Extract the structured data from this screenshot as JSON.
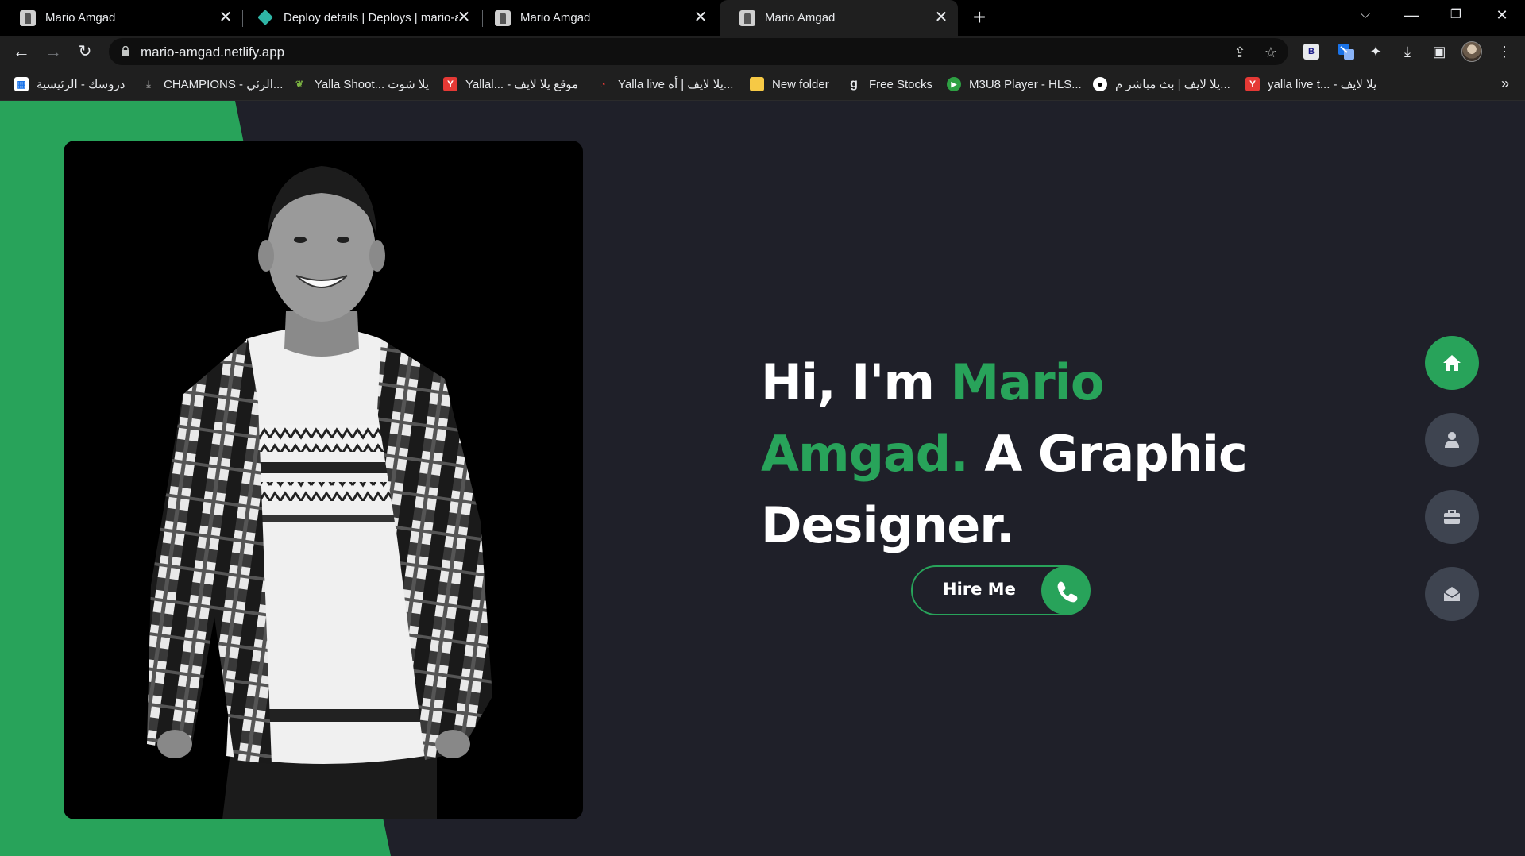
{
  "browser": {
    "tabs": [
      {
        "title": "Mario Amgad",
        "icon": "portrait-favicon"
      },
      {
        "title": "Deploy details | Deploys | mario-a",
        "icon": "netlify-icon"
      },
      {
        "title": "Mario Amgad",
        "icon": "portrait-favicon"
      },
      {
        "title": "Mario Amgad",
        "icon": "portrait-favicon",
        "active": true
      }
    ],
    "url": "mario-amgad.netlify.app",
    "bookmarks": [
      {
        "label": "دروسك - الرئيسية",
        "icon": "site-icon"
      },
      {
        "label": "CHAMPIONS - الرئي...",
        "icon": "download-icon"
      },
      {
        "label": "Yalla Shoot... يلا شوت",
        "icon": "leaf-icon"
      },
      {
        "label": "Yallal... - موقع يلا لايف",
        "icon": "y-icon"
      },
      {
        "label": "Yalla live يلا لايف | أه...",
        "icon": "red-icon"
      },
      {
        "label": "New folder",
        "icon": "folder-icon"
      },
      {
        "label": "Free Stocks",
        "icon": "g-icon"
      },
      {
        "label": "M3U8 Player - HLS...",
        "icon": "play-icon"
      },
      {
        "label": "يلا لايف | بث مباشر م...",
        "icon": "ball-icon"
      },
      {
        "label": "yalla live t... - يلا لايف",
        "icon": "y-icon"
      }
    ]
  },
  "hero": {
    "greeting": "Hi, I'm ",
    "name_first": "Mario",
    "name_last": "Amgad.",
    "role_prefix": " A Graphic",
    "role_suffix": "Designer.",
    "cta_label": "Hire Me"
  },
  "side_nav": [
    {
      "name": "home",
      "icon": "home-icon",
      "active": true
    },
    {
      "name": "about",
      "icon": "user-icon",
      "active": false
    },
    {
      "name": "portfolio",
      "icon": "briefcase-icon",
      "active": false
    },
    {
      "name": "contact",
      "icon": "envelope-open-icon",
      "active": false
    }
  ],
  "colors": {
    "accent": "#28a35a",
    "background": "#1f2029",
    "nav_button": "#3e4450"
  }
}
